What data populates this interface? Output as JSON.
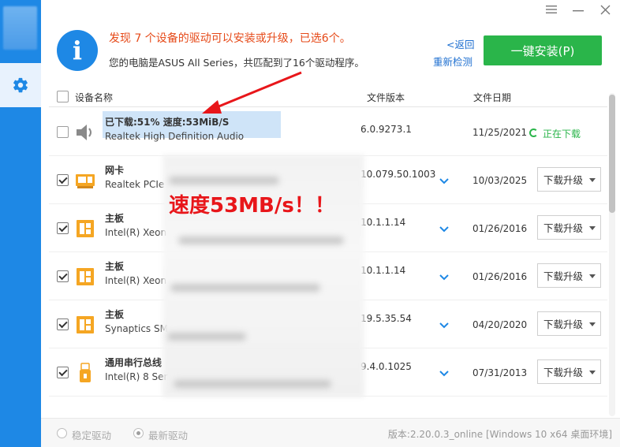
{
  "window": {
    "controls": [
      "menu-icon",
      "minimize-icon",
      "close-icon"
    ]
  },
  "header": {
    "headline": "发现 7 个设备的驱动可以安装或升级，已选6个。",
    "subline": "您的电脑是ASUS All Series，共匹配到了16个驱动程序。",
    "back_link": "<返回",
    "rescan_link": "重新检测",
    "install_button": "一键安装(P)"
  },
  "table": {
    "headers": [
      "设备名称",
      "文件版本",
      "文件日期"
    ],
    "rows": [
      {
        "checked": false,
        "icon": "speaker-icon",
        "name": "已下载:51% 速度:53MiB/S",
        "desc": "Realtek High Definition Audio",
        "version": "6.0.9273.1",
        "date": "11/25/2021",
        "action": "正在下载",
        "downloading": true
      },
      {
        "checked": true,
        "icon": "network-card-icon",
        "name": "网卡",
        "desc": "Realtek PCIe",
        "version": "10.079.50.1003",
        "date": "10/03/2025",
        "action": "下载升级",
        "downloading": false
      },
      {
        "checked": true,
        "icon": "motherboard-icon",
        "name": "主板",
        "desc": "Intel(R) Xeon",
        "version": "10.1.1.14",
        "date": "01/26/2016",
        "action": "下载升级",
        "downloading": false
      },
      {
        "checked": true,
        "icon": "motherboard-icon",
        "name": "主板",
        "desc": "Intel(R) Xeon",
        "version": "10.1.1.14",
        "date": "01/26/2016",
        "action": "下载升级",
        "downloading": false
      },
      {
        "checked": true,
        "icon": "motherboard-icon",
        "name": "主板",
        "desc": "Synaptics SM",
        "version": "19.5.35.54",
        "date": "04/20/2020",
        "action": "下载升级",
        "downloading": false
      },
      {
        "checked": true,
        "icon": "usb-icon",
        "name": "通用串行总线",
        "desc": "Intel(R) 8 Ser",
        "version": "9.4.0.1025",
        "date": "07/31/2013",
        "action": "下载升级",
        "downloading": false
      }
    ]
  },
  "annotation": {
    "text": "速度53MB/s！！"
  },
  "footer": {
    "radio_stable": "稳定驱动",
    "radio_latest": "最新驱动",
    "version": "版本:2.20.0.3_online [Windows 10 x64 桌面环境]"
  },
  "colors": {
    "brand_blue": "#1e88e5",
    "install_green": "#2ab54a",
    "headline_orange": "#e64a19",
    "annotation_red": "#e8161a"
  }
}
